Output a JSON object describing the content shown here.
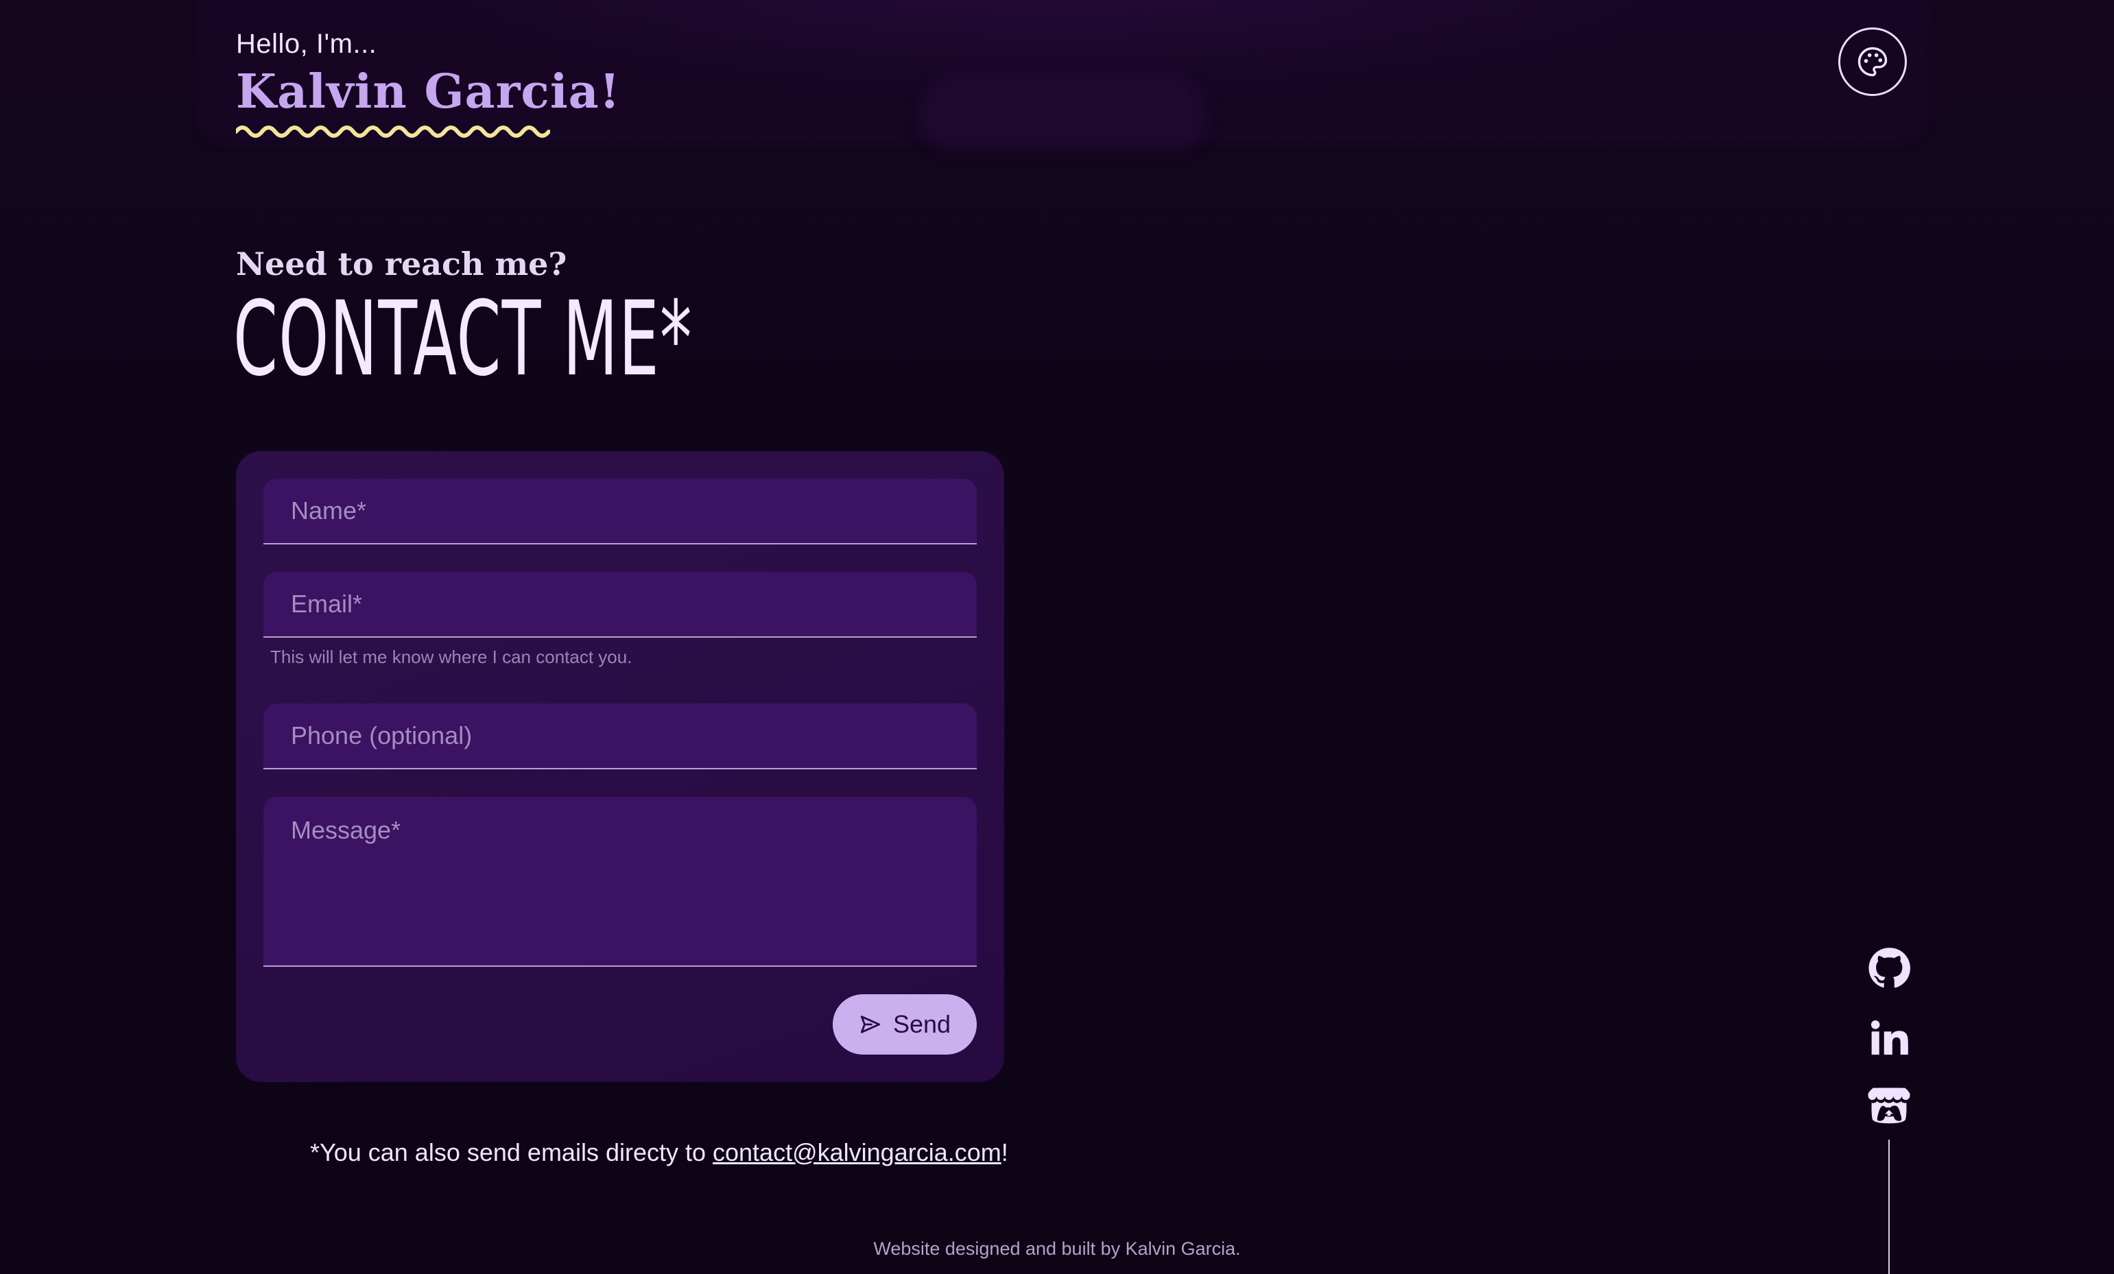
{
  "header": {
    "greeting": "Hello, I'm...",
    "name": "Kalvin Garcia!",
    "theme_button_icon": "palette-icon",
    "squiggle_color": "#f4e49a"
  },
  "contact": {
    "subheading": "Need to reach me?",
    "heading": "CONTACT ME*"
  },
  "form": {
    "name_placeholder": "Name*",
    "email_placeholder": "Email*",
    "email_helper": "This will let me know where I can contact you.",
    "phone_placeholder": "Phone (optional)",
    "message_placeholder": "Message*",
    "send_label": "Send",
    "send_icon": "send-icon"
  },
  "footnote": {
    "prefix": "*You can also send emails directy to ",
    "email": "contact@kalvingarcia.com",
    "suffix": "!"
  },
  "social": {
    "items": [
      {
        "icon": "github-icon"
      },
      {
        "icon": "linkedin-icon"
      },
      {
        "icon": "itchio-icon"
      }
    ]
  },
  "footer": {
    "text": "Website designed and built by Kalvin Garcia."
  },
  "colors": {
    "background": "#0f0519",
    "card": "#2a0c45",
    "field": "#3c1262",
    "accent": "#c7a6f0",
    "button": "#cbb0ef"
  }
}
